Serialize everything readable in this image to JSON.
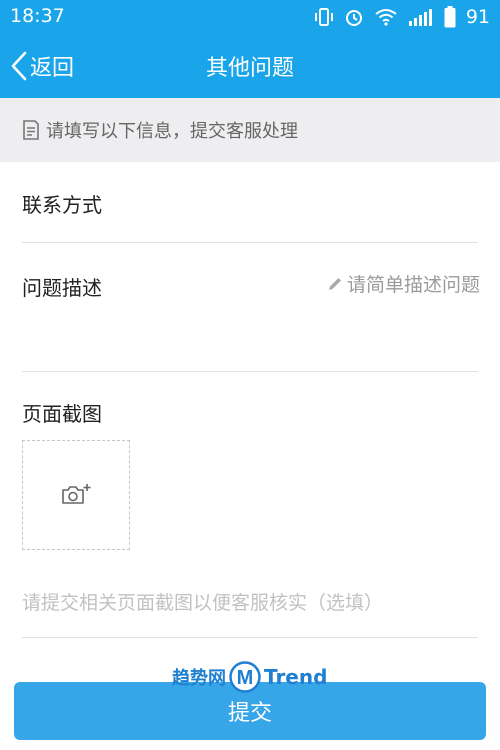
{
  "status_bar": {
    "time": "18:37",
    "battery": "91"
  },
  "header": {
    "back_label": "返回",
    "title": "其他问题"
  },
  "notice": {
    "text": "请填写以下信息，提交客服处理"
  },
  "form": {
    "contact_label": "联系方式",
    "contact_value": "",
    "description_label": "问题描述",
    "description_placeholder": "请简单描述问题",
    "screenshot_label": "页面截图",
    "screenshot_hint": "请提交相关页面截图以便客服核实（选填）"
  },
  "submit_label": "提交",
  "watermark": {
    "cn": "趋势网",
    "mark": "M",
    "en": "Trend"
  },
  "colors": {
    "accent": "#1aa5ea",
    "button": "#36a6e9",
    "notice_bg": "#eeeef0",
    "placeholder": "#9b9b9b"
  },
  "icons": [
    "vibrate-icon",
    "alarm-icon",
    "wifi-icon",
    "signal-icon",
    "battery-icon",
    "back-chevron-icon",
    "note-icon",
    "pencil-icon",
    "camera-add-icon"
  ]
}
